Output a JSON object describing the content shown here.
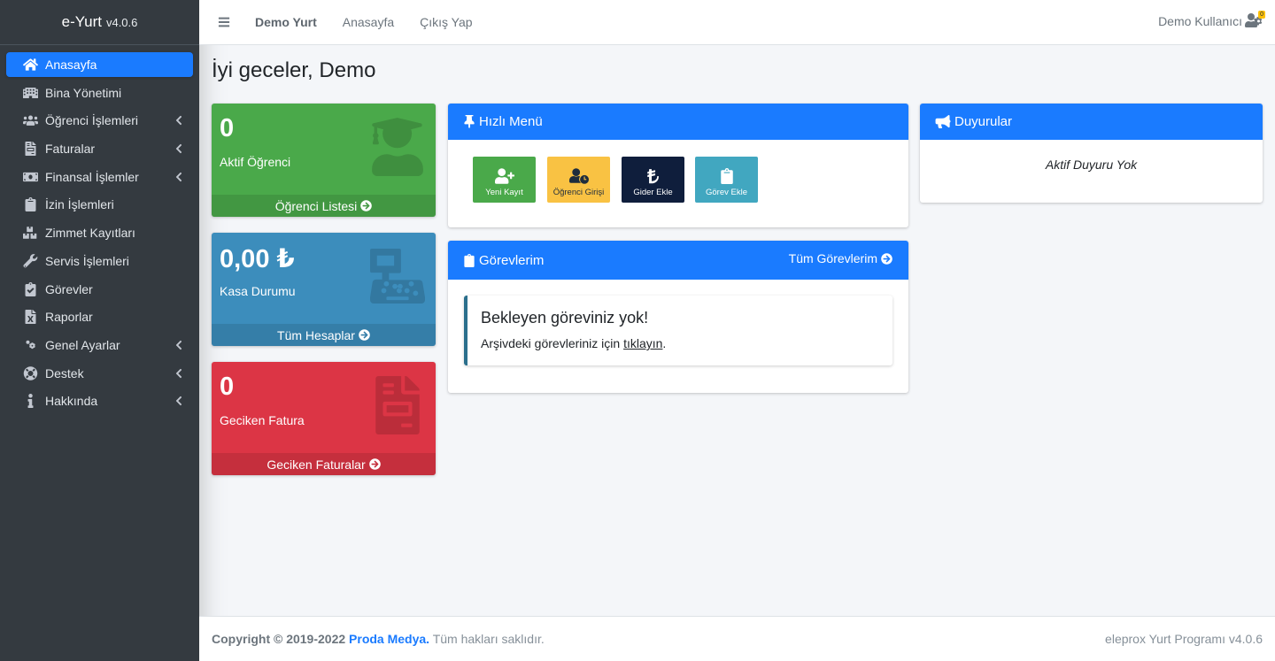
{
  "app": {
    "name": "e-Yurt",
    "version": "v4.0.6"
  },
  "sidebar": {
    "items": [
      {
        "label": "Anasayfa",
        "icon": "home-icon",
        "active": true,
        "chevron": false
      },
      {
        "label": "Bina Yönetimi",
        "icon": "building-icon",
        "chevron": false
      },
      {
        "label": "Öğrenci İşlemleri",
        "icon": "users-icon",
        "chevron": true
      },
      {
        "label": "Faturalar",
        "icon": "file-invoice-icon",
        "chevron": true
      },
      {
        "label": "Finansal İşlemler",
        "icon": "money-bill-icon",
        "chevron": true
      },
      {
        "label": "İzin İşlemleri",
        "icon": "clipboard-icon",
        "chevron": false
      },
      {
        "label": "Zimmet Kayıtları",
        "icon": "boxes-icon",
        "chevron": false
      },
      {
        "label": "Servis İşlemleri",
        "icon": "wrench-icon",
        "chevron": false
      },
      {
        "label": "Görevler",
        "icon": "clipboard-check-icon",
        "chevron": false
      },
      {
        "label": "Raporlar",
        "icon": "file-excel-icon",
        "chevron": false
      },
      {
        "label": "Genel Ayarlar",
        "icon": "cogs-icon",
        "chevron": true
      },
      {
        "label": "Destek",
        "icon": "life-ring-icon",
        "chevron": true
      },
      {
        "label": "Hakkında",
        "icon": "info-icon",
        "chevron": true
      }
    ]
  },
  "topbar": {
    "links": [
      "Demo Yurt",
      "Anasayfa",
      "Çıkış Yap"
    ],
    "user": "Demo Kullanıcı",
    "badge": "0"
  },
  "page": {
    "title": "İyi geceler, Demo"
  },
  "boxes": [
    {
      "value": "0",
      "label": "Aktif Öğrenci",
      "footer": "Öğrenci Listesi",
      "icon": "user-graduate-icon",
      "color": "#4aa94a"
    },
    {
      "value": "0,00 ₺",
      "label": "Kasa Durumu",
      "footer": "Tüm Hesaplar",
      "icon": "cash-register-icon",
      "color": "#3c8dbc"
    },
    {
      "value": "0",
      "label": "Geciken Fatura",
      "footer": "Geciken Faturalar",
      "icon": "file-invoice-icon",
      "color": "#dc3545"
    }
  ],
  "quick_menu": {
    "title": "Hızlı Menü",
    "buttons": [
      {
        "label": "Yeni Kayıt",
        "icon": "user-plus-icon",
        "color": "#4aa94a"
      },
      {
        "label": "Öğrenci Girişi",
        "icon": "user-clock-icon",
        "color": "#f9c243"
      },
      {
        "label": "Gider Ekle",
        "icon": "lira-icon",
        "color": "#0f1e3c"
      },
      {
        "label": "Görev Ekle",
        "icon": "clipboard-icon",
        "color": "#41a7c0"
      }
    ]
  },
  "announcements": {
    "title": "Duyurular",
    "empty": "Aktif Duyuru Yok"
  },
  "tasks": {
    "title": "Görevlerim",
    "all_link": "Tüm Görevlerim",
    "empty_title": "Bekleyen göreviniz yok!",
    "empty_text": "Arşivdeki görevleriniz için",
    "empty_link": "tıklayın",
    "empty_suffix": "."
  },
  "footer": {
    "copyright": "Copyright © 2019-2022",
    "company": "Proda Medya.",
    "rights": "Tüm hakları saklıdır.",
    "program": "eleprox Yurt Programı v4.0.6"
  },
  "colors": {
    "accent": "#1a7bff",
    "sidebar": "#343a40"
  }
}
